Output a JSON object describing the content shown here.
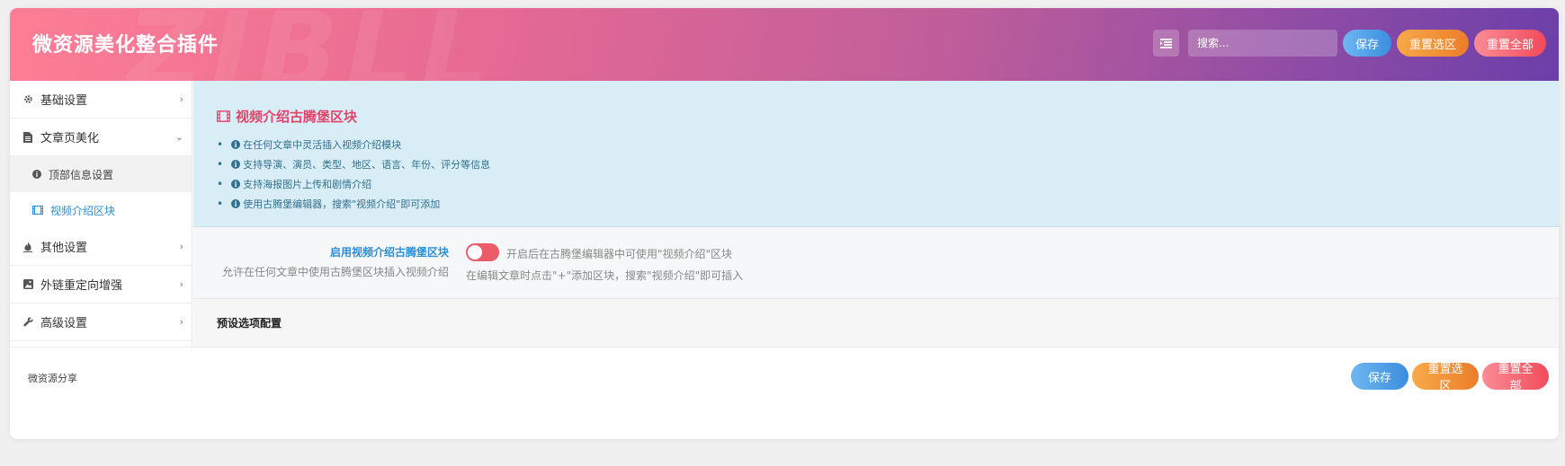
{
  "header": {
    "title": "微资源美化整合插件",
    "watermark": "ZIBLL",
    "search_placeholder": "搜索...",
    "save_label": "保存",
    "reset_section_label": "重置选区",
    "reset_all_label": "重置全部"
  },
  "sidebar": {
    "items": [
      {
        "label": "基础设置",
        "icon": "gear-icon"
      },
      {
        "label": "文章页美化",
        "icon": "file-icon"
      },
      {
        "label": "其他设置",
        "icon": "fire-icon"
      },
      {
        "label": "外链重定向增强",
        "icon": "image-icon"
      },
      {
        "label": "高级设置",
        "icon": "wrench-icon"
      }
    ],
    "sub_items": [
      {
        "label": "顶部信息设置",
        "icon": "info-icon"
      },
      {
        "label": "视频介绍区块",
        "icon": "film-icon"
      }
    ]
  },
  "info": {
    "title": "视频介绍古腾堡区块",
    "items": [
      "在任何文章中灵活插入视频介绍模块",
      "支持导演、演员、类型、地区、语言、年份、评分等信息",
      "支持海报图片上传和剧情介绍",
      "使用古腾堡编辑器，搜索\"视频介绍\"即可添加"
    ]
  },
  "field": {
    "label": "启用视频介绍古腾堡区块",
    "sublabel": "允许在任何文章中使用古腾堡区块插入视频介绍",
    "toggle_state": "on",
    "desc1": "开启后在古腾堡编辑器中可使用\"视频介绍\"区块",
    "desc2": "在编辑文章时点击\"+\"添加区块，搜索\"视频介绍\"即可插入"
  },
  "preset": {
    "title": "预设选项配置"
  },
  "footer": {
    "text": "微资源分享",
    "save_label": "保存",
    "reset_section_label": "重置选区",
    "reset_all_label": "重置全部"
  },
  "colors": {
    "accent_blue": "#2c8fd6",
    "accent_pink": "#e5426a",
    "toggle_color": "#ec5b6a",
    "info_bg": "#d9edf6"
  }
}
